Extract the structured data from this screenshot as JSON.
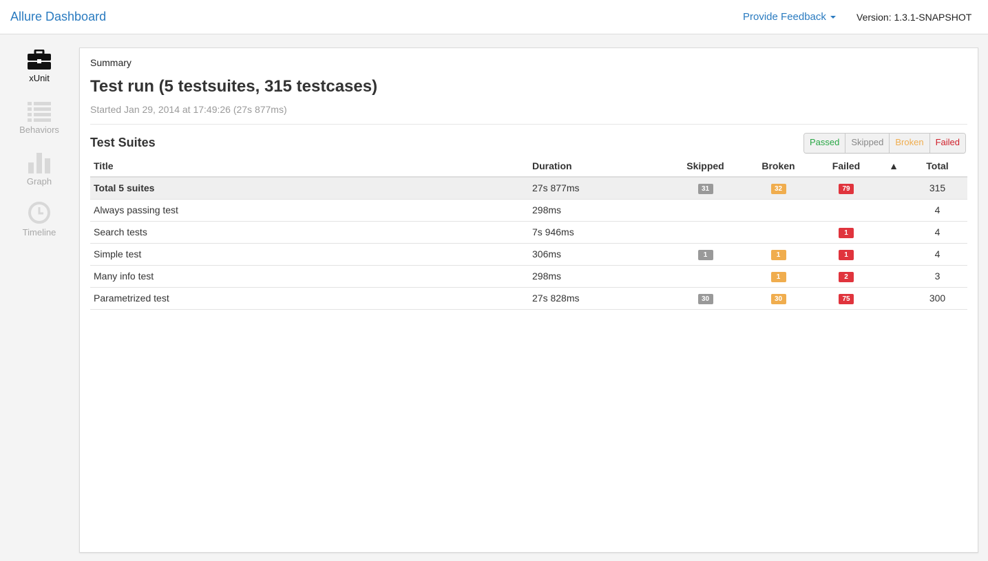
{
  "header": {
    "brand": "Allure Dashboard",
    "feedback": "Provide Feedback",
    "version": "Version: 1.3.1-SNAPSHOT"
  },
  "sidebar": {
    "items": [
      {
        "label": "xUnit",
        "icon": "briefcase-icon",
        "active": true
      },
      {
        "label": "Behaviors",
        "icon": "list-icon",
        "active": false
      },
      {
        "label": "Graph",
        "icon": "bar-chart-icon",
        "active": false
      },
      {
        "label": "Timeline",
        "icon": "clock-icon",
        "active": false
      }
    ]
  },
  "summary": {
    "label": "Summary",
    "title": "Test run (5 testsuites, 315 testcases)",
    "subtitle": "Started Jan 29, 2014 at 17:49:26 (27s 877ms)"
  },
  "suites": {
    "heading": "Test Suites",
    "filters": [
      {
        "label": "Passed",
        "color": "#29a745"
      },
      {
        "label": "Skipped",
        "color": "#888888"
      },
      {
        "label": "Broken",
        "color": "#f0ad4e"
      },
      {
        "label": "Failed",
        "color": "#d0202b"
      }
    ],
    "columns": {
      "title": "Title",
      "duration": "Duration",
      "skipped": "Skipped",
      "broken": "Broken",
      "failed": "Failed",
      "sort": "▲",
      "total": "Total"
    },
    "rows": [
      {
        "title": "Total 5 suites",
        "duration": "27s 877ms",
        "skipped": "31",
        "broken": "32",
        "failed": "79",
        "total": "315"
      },
      {
        "title": "Always passing test",
        "duration": "298ms",
        "skipped": "",
        "broken": "",
        "failed": "",
        "total": "4"
      },
      {
        "title": "Search tests",
        "duration": "7s 946ms",
        "skipped": "",
        "broken": "",
        "failed": "1",
        "total": "4"
      },
      {
        "title": "Simple test",
        "duration": "306ms",
        "skipped": "1",
        "broken": "1",
        "failed": "1",
        "total": "4"
      },
      {
        "title": "Many info test",
        "duration": "298ms",
        "skipped": "",
        "broken": "1",
        "failed": "2",
        "total": "3"
      },
      {
        "title": "Parametrized test",
        "duration": "27s 828ms",
        "skipped": "30",
        "broken": "30",
        "failed": "75",
        "total": "300"
      }
    ]
  }
}
